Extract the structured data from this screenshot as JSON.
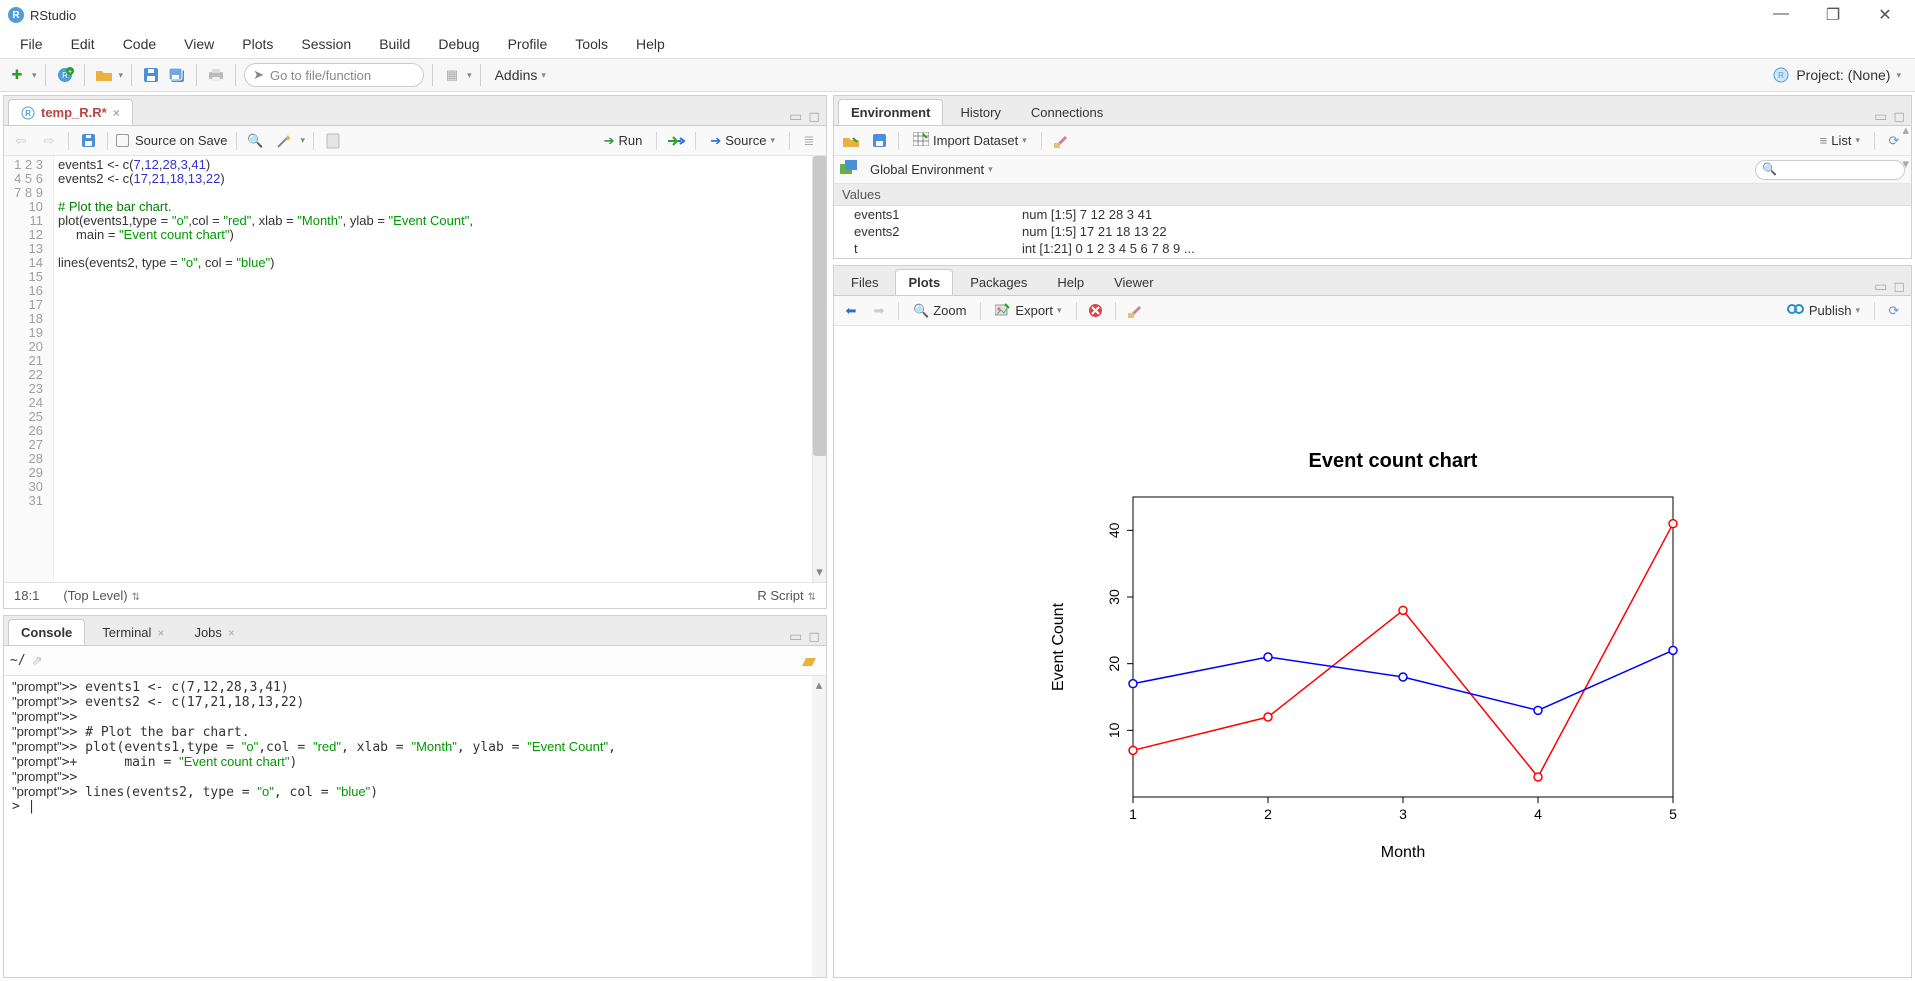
{
  "app": {
    "title": "RStudio"
  },
  "menu": {
    "items": [
      "File",
      "Edit",
      "Code",
      "View",
      "Plots",
      "Session",
      "Build",
      "Debug",
      "Profile",
      "Tools",
      "Help"
    ]
  },
  "toolbar": {
    "goto_placeholder": "Go to file/function",
    "addins": "Addins",
    "project_label": "Project: (None)"
  },
  "editor": {
    "tab_name": "temp_R.R*",
    "source_on_save": "Source on Save",
    "run": "Run",
    "source": "Source",
    "cursor": "18:1",
    "scope": "(Top Level)",
    "lang": "R Script",
    "line_count": 31,
    "code_plain": "events1 <- c(7,12,28,3,41)\nevents2 <- c(17,21,18,13,22)\n\n# Plot the bar chart.\nplot(events1,type = \"o\",col = \"red\", xlab = \"Month\", ylab = \"Event Count\",\n     main = \"Event count chart\")\n\nlines(events2, type = \"o\", col = \"blue\")"
  },
  "console": {
    "tabs": [
      "Console",
      "Terminal",
      "Jobs"
    ],
    "cwd": "~/",
    "lines": [
      "> events1 <- c(7,12,28,3,41)",
      "> events2 <- c(17,21,18,13,22)",
      "> ",
      "> # Plot the bar chart.",
      "> plot(events1,type = \"o\",col = \"red\", xlab = \"Month\", ylab = \"Event Count\",",
      "+      main = \"Event count chart\")",
      "> ",
      "> lines(events2, type = \"o\", col = \"blue\")"
    ]
  },
  "env": {
    "tabs": [
      "Environment",
      "History",
      "Connections"
    ],
    "import": "Import Dataset",
    "scope": "Global Environment",
    "list": "List",
    "section": "Values",
    "rows": [
      {
        "name": "events1",
        "value": "num [1:5] 7 12 28 3 41"
      },
      {
        "name": "events2",
        "value": "num [1:5] 17 21 18 13 22"
      },
      {
        "name": "t",
        "value": "int [1:21] 0 1 2 3 4 5 6 7 8 9 ..."
      }
    ]
  },
  "plots": {
    "tabs": [
      "Files",
      "Plots",
      "Packages",
      "Help",
      "Viewer"
    ],
    "zoom": "Zoom",
    "export": "Export",
    "publish": "Publish"
  },
  "chart_data": {
    "type": "line",
    "title": "Event count chart",
    "xlabel": "Month",
    "ylabel": "Event Count",
    "x": [
      1,
      2,
      3,
      4,
      5
    ],
    "xticks": [
      1,
      2,
      3,
      4,
      5
    ],
    "yticks": [
      10,
      20,
      30,
      40
    ],
    "ylim": [
      0,
      45
    ],
    "series": [
      {
        "name": "events1",
        "color": "red",
        "values": [
          7,
          12,
          28,
          3,
          41
        ]
      },
      {
        "name": "events2",
        "color": "blue",
        "values": [
          17,
          21,
          18,
          13,
          22
        ]
      }
    ]
  }
}
